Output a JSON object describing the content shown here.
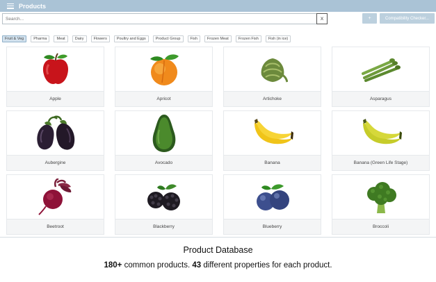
{
  "header": {
    "title": "Products"
  },
  "search": {
    "placeholder": "Search...",
    "clear_label": "X"
  },
  "actions": {
    "add_label": "+",
    "compat_label": "Compatibility Checker..."
  },
  "filters": [
    "Fruit & Veg",
    "Pharma",
    "Meat",
    "Dairy",
    "Flowers",
    "Poultry and Eggs",
    "Product Group",
    "Fish",
    "Frozen Meat",
    "Frozen Fish",
    "Fish (in ice)"
  ],
  "active_filter": "Fruit & Veg",
  "products": [
    {
      "name": "Apple",
      "icon": "apple-icon"
    },
    {
      "name": "Apricot",
      "icon": "apricot-icon"
    },
    {
      "name": "Artichoke",
      "icon": "artichoke-icon"
    },
    {
      "name": "Asparagus",
      "icon": "asparagus-icon"
    },
    {
      "name": "Aubergine",
      "icon": "aubergine-icon"
    },
    {
      "name": "Avocado",
      "icon": "avocado-icon"
    },
    {
      "name": "Banana",
      "icon": "banana-icon"
    },
    {
      "name": "Banana (Green Life Stage)",
      "icon": "green-banana-icon"
    },
    {
      "name": "Beetroot",
      "icon": "beetroot-icon"
    },
    {
      "name": "Blackberry",
      "icon": "blackberry-icon"
    },
    {
      "name": "Blueberry",
      "icon": "blueberry-icon"
    },
    {
      "name": "Broccoli",
      "icon": "broccoli-icon"
    }
  ],
  "caption": {
    "heading": "Product Database",
    "count": "180+",
    "count_text": " common products. ",
    "props": "43",
    "props_text": " different properties for each product."
  },
  "colors": {
    "titlebar": "#aac3d6",
    "button": "#bcd0de",
    "active_chip": "#d3e2ee"
  }
}
